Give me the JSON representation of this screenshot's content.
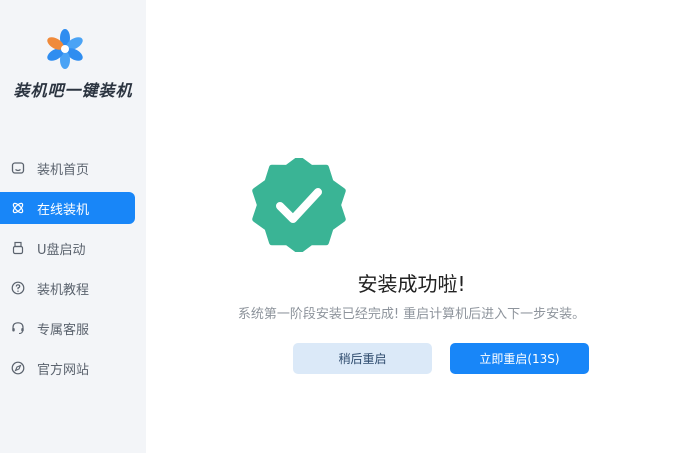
{
  "app": {
    "name": "装机吧一键装机",
    "logo_icon": "pinwheel-flower-logo"
  },
  "sidebar": {
    "items": [
      {
        "label": "装机首页",
        "icon": "home-icon",
        "active": false
      },
      {
        "label": "在线装机",
        "icon": "atom-icon",
        "active": true
      },
      {
        "label": "U盘启动",
        "icon": "usb-drive-icon",
        "active": false
      },
      {
        "label": "装机教程",
        "icon": "question-circle-icon",
        "active": false
      },
      {
        "label": "专属客服",
        "icon": "headset-icon",
        "active": false
      },
      {
        "label": "官方网站",
        "icon": "compass-icon",
        "active": false
      }
    ]
  },
  "result": {
    "icon": "check-badge-icon",
    "title": "安装成功啦!",
    "message": "系统第一阶段安装已经完成! 重启计算机后进入下一步安装。"
  },
  "buttons": {
    "later_label": "稍后重启",
    "now_label": "立即重启(13S)"
  },
  "colors": {
    "accent": "#1886f8",
    "success": "#3ab495",
    "sidebar_bg": "#f3f5f8",
    "secondary_button_bg": "#dbe9f8"
  }
}
